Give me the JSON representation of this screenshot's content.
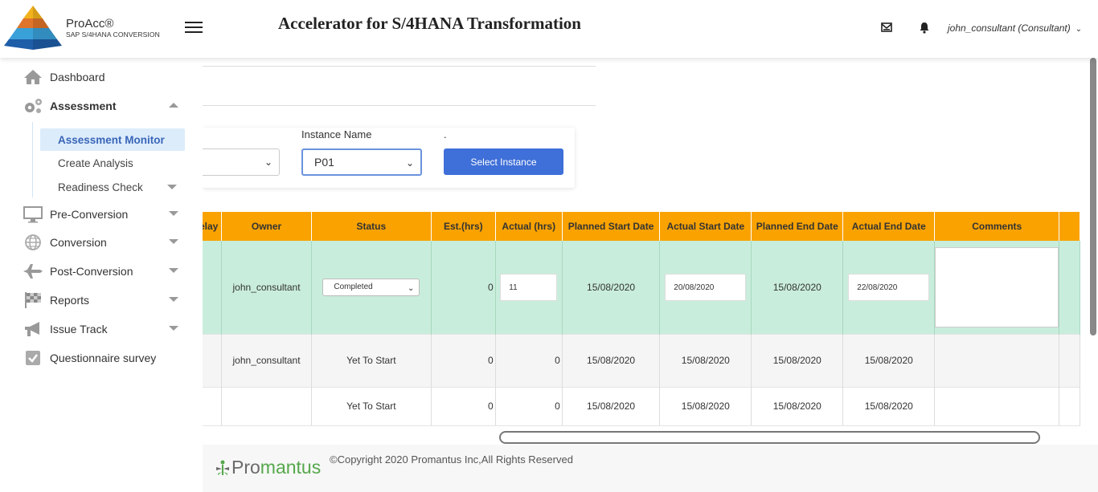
{
  "header": {
    "brand_name": "ProAcc®",
    "brand_sub": "SAP S/4HANA CONVERSION",
    "app_title": "Accelerator for S/4HANA Transformation",
    "user": "john_consultant (Consultant)"
  },
  "sidebar": {
    "items": [
      {
        "label": "Dashboard"
      },
      {
        "label": "Assessment"
      },
      {
        "label": "Pre-Conversion"
      },
      {
        "label": "Conversion"
      },
      {
        "label": "Post-Conversion"
      },
      {
        "label": "Reports"
      },
      {
        "label": "Issue Track"
      },
      {
        "label": "Questionnaire survey"
      }
    ],
    "sub_items": [
      {
        "label": "Assessment Monitor"
      },
      {
        "label": "Create Analysis"
      },
      {
        "label": "Readiness Check"
      }
    ]
  },
  "filter": {
    "instance_label": "Instance Name",
    "instance_value": "P01",
    "dot_label": ".",
    "select_button": "Select Instance"
  },
  "table": {
    "headers": [
      "elay",
      "Owner",
      "Status",
      "Est.(hrs)",
      "Actual (hrs)",
      "Planned Start Date",
      "Actual Start Date",
      "Planned End Date",
      "Actual End Date",
      "Comments"
    ],
    "rows": [
      {
        "owner": "john_consultant",
        "status": "Completed",
        "est": "0",
        "actual": "11",
        "planned_start": "15/08/2020",
        "actual_start": "20/08/2020",
        "planned_end": "15/08/2020",
        "actual_end": "22/08/2020",
        "comments": ""
      },
      {
        "owner": "john_consultant",
        "status": "Yet To Start",
        "est": "0",
        "actual": "0",
        "planned_start": "15/08/2020",
        "actual_start": "15/08/2020",
        "planned_end": "15/08/2020",
        "actual_end": "15/08/2020",
        "comments": ""
      },
      {
        "owner": "",
        "status": "Yet To Start",
        "est": "0",
        "actual": "0",
        "planned_start": "15/08/2020",
        "actual_start": "15/08/2020",
        "planned_end": "15/08/2020",
        "actual_end": "15/08/2020",
        "comments": ""
      }
    ]
  },
  "footer": {
    "brand_a": "Pro",
    "brand_b": "mantus",
    "copyright": "©Copyright 2020 Promantus Inc,All Rights Reserved"
  },
  "colors": {
    "header_orange": "#f9a200",
    "active_row": "#c9eddc",
    "primary_button": "#3f6fd8",
    "active_nav": "#dcecfb"
  }
}
